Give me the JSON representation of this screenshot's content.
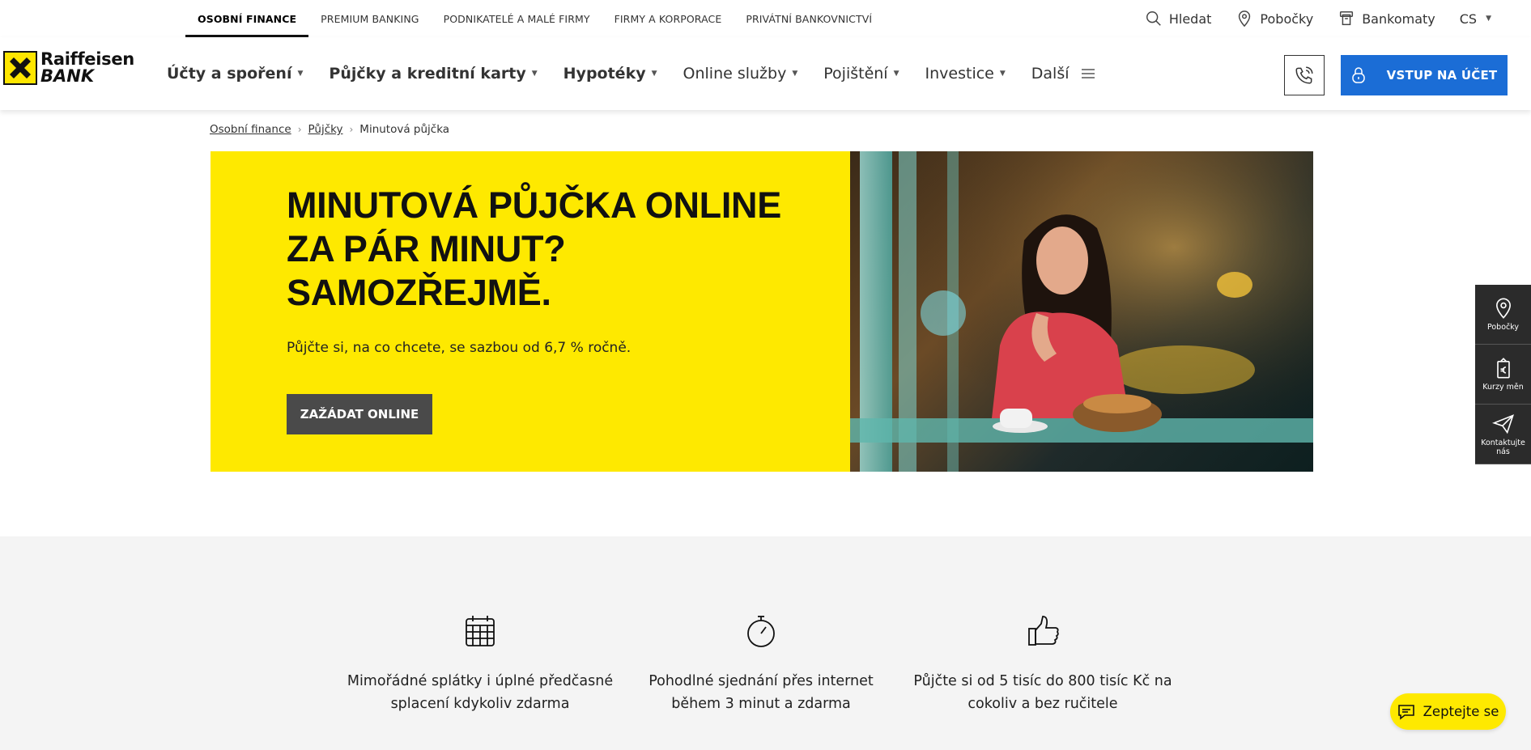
{
  "segments": [
    {
      "label": "OSOBNÍ FINANCE",
      "active": true
    },
    {
      "label": "PREMIUM BANKING"
    },
    {
      "label": "PODNIKATELÉ A MALÉ FIRMY"
    },
    {
      "label": "FIRMY A KORPORACE"
    },
    {
      "label": "PRIVÁTNÍ BANKOVNICTVÍ"
    }
  ],
  "utility": {
    "search": "Hledat",
    "branches": "Pobočky",
    "atms": "Bankomaty",
    "language": "CS"
  },
  "logo": {
    "line1": "Raiffeisen",
    "line2": "BANK"
  },
  "menu": [
    {
      "label": "Účty a spoření"
    },
    {
      "label": "Půjčky a kreditní karty"
    },
    {
      "label": "Hypotéky"
    },
    {
      "label": "Online služby"
    },
    {
      "label": "Pojištění"
    },
    {
      "label": "Investice"
    },
    {
      "label": "Další"
    }
  ],
  "login_label": "VSTUP NA ÚČET",
  "breadcrumb": {
    "home": "Osobní finance",
    "loans": "Půjčky",
    "current": "Minutová půjčka"
  },
  "hero": {
    "line1": "MINUTOVÁ PŮJČKA ONLINE",
    "line2": "ZA PÁR MINUT?",
    "line3": "SAMOZŘEJMĚ.",
    "subtitle": "Půjčte si, na co chcete, se sazbou od 6,7 % ročně.",
    "cta": "ZAŽÁDAT ONLINE"
  },
  "side": {
    "branches": "Pobočky",
    "rates": "Kurzy měn",
    "contact": "Kontaktujte nás"
  },
  "features": [
    {
      "icon": "calendar-icon",
      "text": "Mimořádné splátky i úplné předčasné splacení kdykoliv zdarma"
    },
    {
      "icon": "stopwatch-icon",
      "text": "Pohodlné sjednání přes internet během 3 minut a zdarma"
    },
    {
      "icon": "thumbs-up-icon",
      "text": "Půjčte si od 5 tisíc do 800 tisíc Kč na cokoliv a bez ručitele"
    }
  ],
  "chat_label": "Zeptejte se",
  "colors": {
    "brand_yellow": "#fee900",
    "cta_blue": "#1b6dd6",
    "dark": "#2b2b2b"
  }
}
